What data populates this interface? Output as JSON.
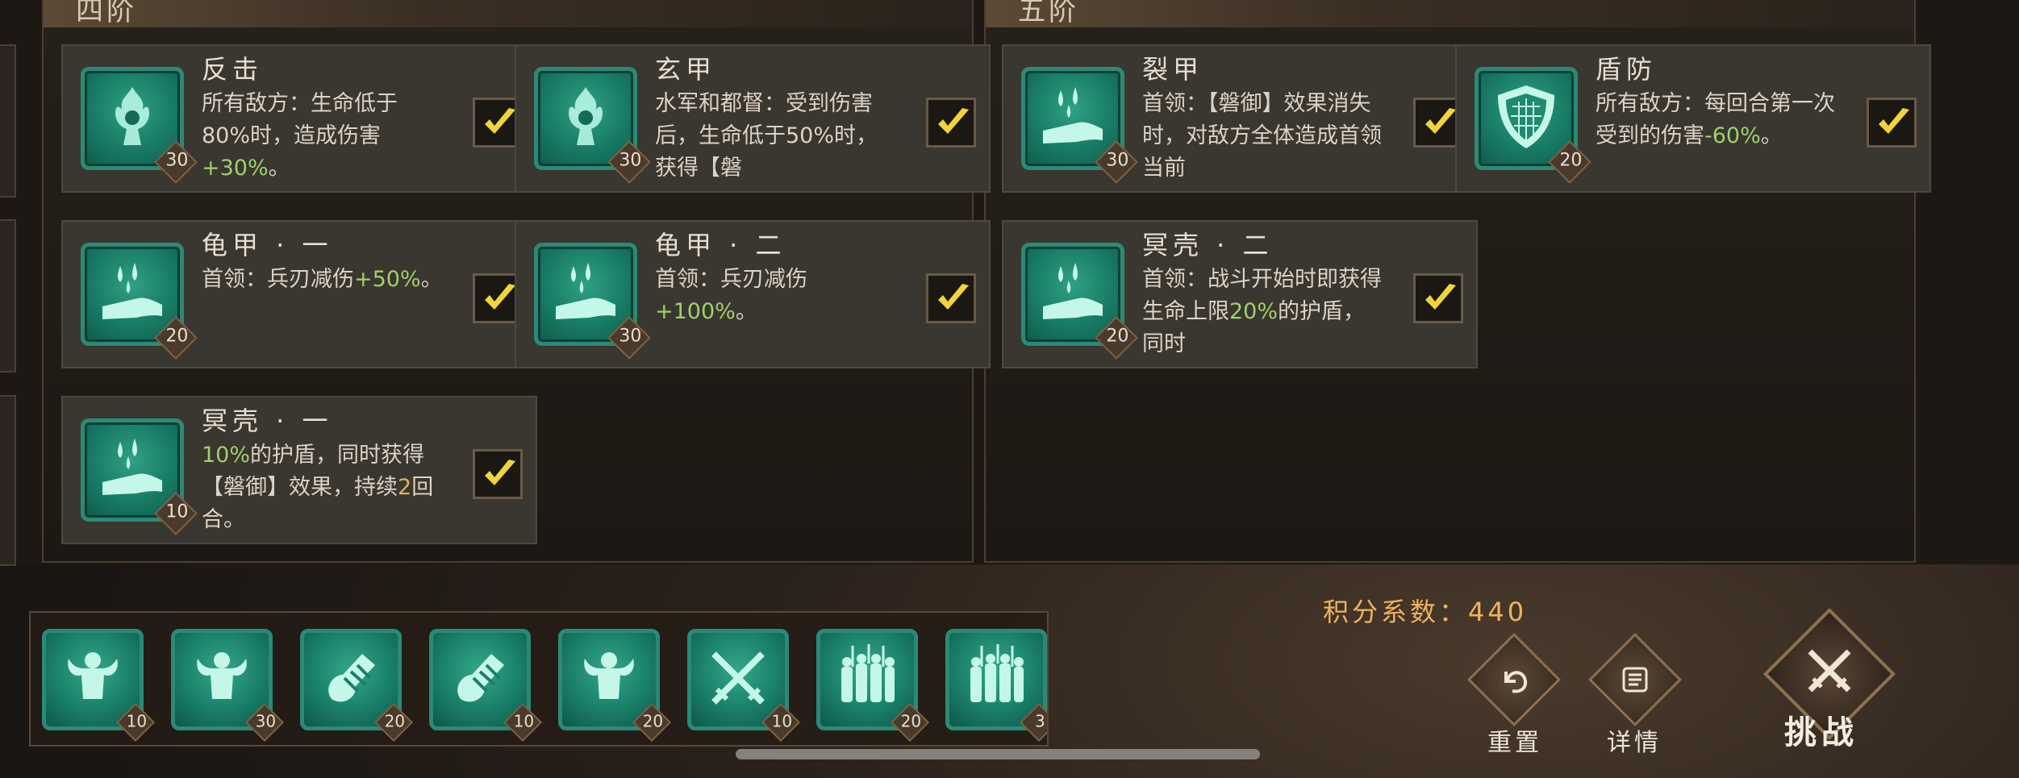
{
  "tiers": [
    {
      "title": "四阶"
    },
    {
      "title": "五阶"
    }
  ],
  "cards": [
    {
      "title": "反击",
      "icon": "flame-figure-icon",
      "level": "30",
      "desc": [
        {
          "t": "所有敌方：生命低于80%时，造成伤害"
        },
        {
          "t": "+30%",
          "c": "g"
        },
        {
          "t": "。"
        }
      ]
    },
    {
      "title": "玄甲",
      "icon": "flame-figure-icon",
      "level": "30",
      "desc": [
        {
          "t": "水军和都督：受到伤害后，生命低于"
        },
        {
          "t": "50%时，获得【磐"
        }
      ]
    },
    {
      "title": "龟甲 · 一",
      "icon": "hand-drops-icon",
      "level": "20",
      "desc": [
        {
          "t": "首领：兵刃减伤"
        },
        {
          "t": "+50%",
          "c": "g"
        },
        {
          "t": "。"
        }
      ]
    },
    {
      "title": "龟甲 · 二",
      "icon": "hand-drops-icon",
      "level": "30",
      "desc": [
        {
          "t": "首领：兵刃减伤"
        },
        {
          "t": "+100%",
          "c": "g"
        },
        {
          "t": "。"
        }
      ]
    },
    {
      "title": "冥壳 · 一",
      "icon": "hand-drops-icon",
      "level": "10",
      "desc": [
        {
          "t": "10%",
          "c": "g"
        },
        {
          "t": "的护盾，同时获得【磐御】效果，持续"
        },
        {
          "t": "2",
          "c": "o"
        },
        {
          "t": "回合。"
        }
      ]
    },
    {
      "title": "裂甲",
      "icon": "hand-drops-icon",
      "level": "30",
      "desc": [
        {
          "t": "首领：【磐御】效果消失时，对敌方全体造成首领当前"
        }
      ]
    },
    {
      "title": "盾防",
      "icon": "shield-icon",
      "level": "20",
      "desc": [
        {
          "t": "所有敌方：每回合第一次受到的伤害"
        },
        {
          "t": "-60%",
          "c": "g"
        },
        {
          "t": "。"
        }
      ]
    },
    {
      "title": "冥壳 · 二",
      "icon": "hand-drops-icon",
      "level": "20",
      "desc": [
        {
          "t": "首领：战斗开始时即获得生命上限"
        },
        {
          "t": "20%",
          "c": "g"
        },
        {
          "t": "的护盾，同时"
        }
      ]
    }
  ],
  "bottom_slots": [
    {
      "icon": "strongman-icon",
      "level": "10"
    },
    {
      "icon": "strongman-icon",
      "level": "30"
    },
    {
      "icon": "arm-wrap-icon",
      "level": "20"
    },
    {
      "icon": "arm-wrap-icon",
      "level": "10"
    },
    {
      "icon": "strongman-icon",
      "level": "20"
    },
    {
      "icon": "crossed-swords-icon",
      "level": "10"
    },
    {
      "icon": "army-icon",
      "level": "20"
    },
    {
      "icon": "army-icon",
      "level": "3"
    }
  ],
  "score_text": "积分系数：440",
  "buttons": {
    "reset": "重置",
    "details": "详情",
    "challenge": "挑战"
  },
  "colors": {
    "accent_green": "#9fd16a",
    "accent_orange": "#f0b35c",
    "icon_teal": "#1a7f69"
  }
}
